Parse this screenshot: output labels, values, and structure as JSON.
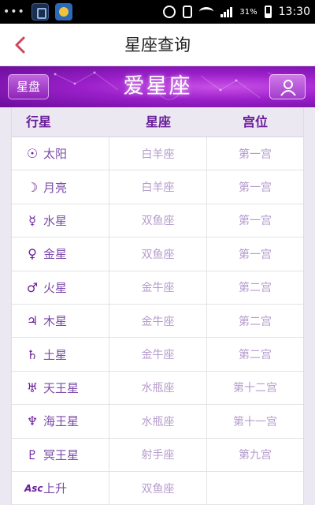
{
  "status_bar": {
    "dots": "•••",
    "battery_percent": "31%",
    "time": "13:30",
    "icons": [
      "app-icon-1",
      "app-icon-2",
      "alarm-icon",
      "phone-icon",
      "wifi-icon",
      "signal-icon",
      "battery-icon"
    ]
  },
  "header": {
    "title": "星座查询",
    "back_icon": "chevron-left-icon"
  },
  "banner": {
    "left_button": "星盘",
    "brand": "爱星座",
    "right_icon": "user-icon"
  },
  "table": {
    "columns": [
      "行星",
      "星座",
      "宫位"
    ],
    "rows": [
      {
        "symbol": "☉",
        "planet": "太阳",
        "sign": "白羊座",
        "house": "第一宫"
      },
      {
        "symbol": "☽",
        "planet": "月亮",
        "sign": "白羊座",
        "house": "第一宫"
      },
      {
        "symbol": "☿",
        "planet": "水星",
        "sign": "双鱼座",
        "house": "第一宫"
      },
      {
        "symbol": "♀",
        "planet": "金星",
        "sign": "双鱼座",
        "house": "第一宫"
      },
      {
        "symbol": "♂",
        "planet": "火星",
        "sign": "金牛座",
        "house": "第二宫"
      },
      {
        "symbol": "♃",
        "planet": "木星",
        "sign": "金牛座",
        "house": "第二宫"
      },
      {
        "symbol": "♄",
        "planet": "土星",
        "sign": "金牛座",
        "house": "第二宫"
      },
      {
        "symbol": "♅",
        "planet": "天王星",
        "sign": "水瓶座",
        "house": "第十二宫"
      },
      {
        "symbol": "♆",
        "planet": "海王星",
        "sign": "水瓶座",
        "house": "第十一宫"
      },
      {
        "symbol": "♇",
        "planet": "冥王星",
        "sign": "射手座",
        "house": "第九宫"
      },
      {
        "symbol": "Asc",
        "planet": "上升",
        "sign": "双鱼座",
        "house": ""
      }
    ]
  },
  "colors": {
    "accent": "#8e24b8",
    "back_arrow": "#d0455a",
    "header_text": "#6a1d9a"
  }
}
